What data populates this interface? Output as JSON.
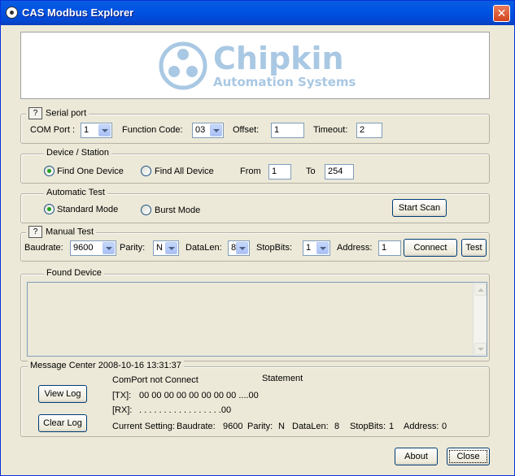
{
  "window": {
    "title": "CAS Modbus Explorer",
    "close_glyph": "✕"
  },
  "logo": {
    "brand": "Chipkin",
    "tagline": "Automation Systems",
    "color": "#a9c8e3"
  },
  "serial_port": {
    "help_label": "?",
    "title": "Serial port",
    "com_port_label": "COM Port :",
    "com_port_value": "1",
    "function_code_label": "Function Code:",
    "function_code_value": "03",
    "offset_label": "Offset:",
    "offset_value": "1",
    "timeout_label": "Timeout:",
    "timeout_value": "2"
  },
  "device_station": {
    "title": "Device / Station",
    "find_one_label": "Find One Device",
    "find_all_label": "Find All Device",
    "selected": "find_one",
    "from_label": "From",
    "from_value": "1",
    "to_label": "To",
    "to_value": "254"
  },
  "automatic_test": {
    "title": "Automatic Test",
    "standard_label": "Standard Mode",
    "burst_label": "Burst Mode",
    "selected": "standard",
    "start_scan_label": "Start Scan"
  },
  "manual_test": {
    "help_label": "?",
    "title": "Manual Test",
    "baudrate_label": "Baudrate:",
    "baudrate_value": "9600",
    "parity_label": "Parity:",
    "parity_value": "N",
    "datalen_label": "DataLen:",
    "datalen_value": "8",
    "stopbits_label": "StopBits:",
    "stopbits_value": "1",
    "address_label": "Address:",
    "address_value": "1",
    "connect_label": "Connect",
    "test_label": "Test"
  },
  "found_device": {
    "title": "Found Device"
  },
  "message_center": {
    "title": "Message Center 2008-10-16  13:31:37",
    "view_log_label": "View Log",
    "clear_log_label": "Clear Log",
    "status": "ComPort not Connect",
    "statement_label": "Statement",
    "tx_label": "[TX]:",
    "tx_value": "00 00 00 00 00 00 00 00 ....00",
    "rx_label": "[RX]:",
    "rx_value": ". . . . . . . . . . . . . . . . .00",
    "current_setting": {
      "label": "Current Setting:",
      "baudrate_label": "Baudrate:",
      "baudrate_value": "9600",
      "parity_label": "Parity:",
      "parity_value": "N",
      "datalen_label": "DataLen:",
      "datalen_value": "8",
      "stopbits_label": "StopBits:",
      "stopbits_value": "1",
      "address_label": "Address:",
      "address_value": "0"
    }
  },
  "footer": {
    "about_label": "About",
    "close_label": "Close"
  }
}
